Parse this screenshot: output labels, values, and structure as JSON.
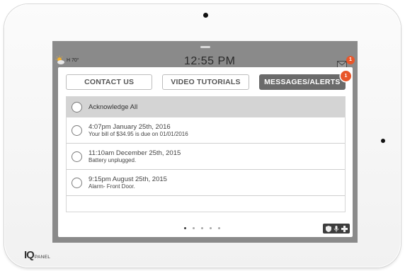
{
  "status_bar": {
    "weather_label": "H 70°",
    "time": "12:55 PM",
    "mail_badge": "1"
  },
  "tabs": [
    {
      "label": "CONTACT US",
      "active": false
    },
    {
      "label": "VIDEO TUTORIALS",
      "active": false
    },
    {
      "label": "MESSAGES/ALERTS",
      "active": true,
      "badge": "1"
    }
  ],
  "acknowledge_all_label": "Acknowledge All",
  "messages": [
    {
      "title": "4:07pm January 25th, 2016",
      "body": "Your bill of $34.95 is due on 01/01/2016"
    },
    {
      "title": "11:10am December 25th, 2015",
      "body": "Battery unplugged."
    },
    {
      "title": "9:15pm August 25th, 2015",
      "body": "Alarm- Front Door."
    }
  ],
  "pager": {
    "pages": 5,
    "current": 0
  },
  "logo": {
    "mark": "IQ",
    "text": "PANEL"
  },
  "colors": {
    "badge": "#e8562a",
    "active_tab": "#6b6b6b",
    "screen_bg": "#8a8a8a"
  }
}
